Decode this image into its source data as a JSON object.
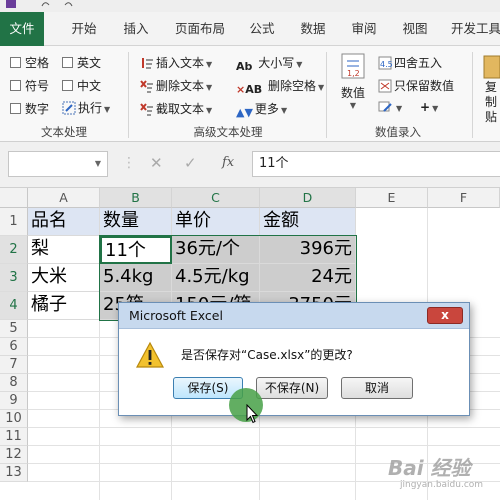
{
  "ribbon_tabs": [
    "文件",
    "开始",
    "插入",
    "页面布局",
    "公式",
    "数据",
    "审阅",
    "视图",
    "开发工具"
  ],
  "text_group": {
    "label": "文本处理",
    "checkboxes": [
      "空格",
      "英文",
      "符号",
      "中文",
      "数字",
      "执行"
    ]
  },
  "advanced_group": {
    "label": "高级文本处理",
    "buttons": [
      "插入文本",
      "删除文本",
      "截取文本",
      "大小写",
      "删除空格",
      "更多"
    ]
  },
  "entry_group": {
    "label": "数值录入",
    "buttons": [
      "数值",
      "四舍五入",
      "只保留数值"
    ],
    "partial_label": "复制\n贴"
  },
  "formula_bar": {
    "fx": "fx",
    "value": "11个"
  },
  "columns": [
    "A",
    "B",
    "C",
    "D",
    "E",
    "F"
  ],
  "rows": [
    "1",
    "2",
    "3",
    "4",
    "5",
    "6",
    "7",
    "8",
    "9",
    "10",
    "11",
    "12",
    "13"
  ],
  "table": {
    "header": [
      "品名",
      "数量",
      "单价",
      "金额"
    ],
    "data": [
      [
        "梨",
        "11个",
        "36元/个",
        "396元"
      ],
      [
        "大米",
        "5.4kg",
        "4.5元/kg",
        "24元"
      ],
      [
        "橘子",
        "25箱",
        "150元/箱",
        "3750元"
      ]
    ]
  },
  "dialog": {
    "title": "Microsoft Excel",
    "close": "x",
    "message": "是否保存对“Case.xlsx”的更改?",
    "buttons": [
      "保存(S)",
      "不保存(N)",
      "取消"
    ]
  },
  "watermark": {
    "text": "Bai 经验",
    "url": "jingyan.baidu.com"
  },
  "colors": {
    "excel_green": "#217346",
    "header_fill": "#dde5f3",
    "gray_fill": "#cdcdcd"
  }
}
